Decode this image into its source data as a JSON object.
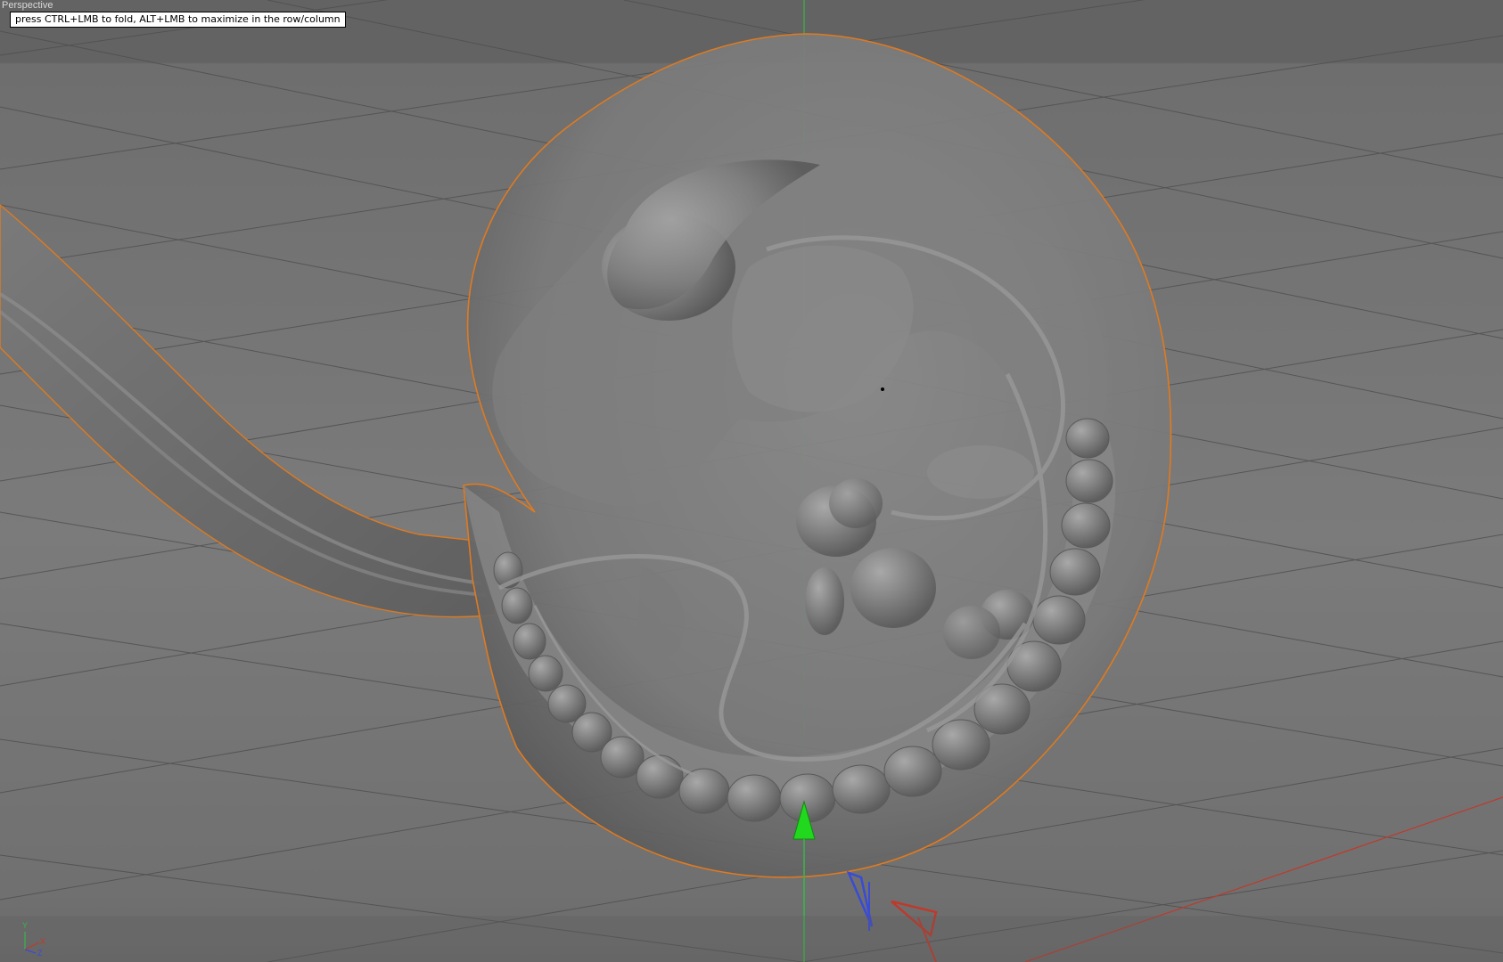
{
  "viewport": {
    "label": "Perspective",
    "tooltip": "press CTRL+LMB to fold, ALT+LMB to maximize in the row/column"
  },
  "axis_indicator": {
    "y_label": "Y",
    "x_label": "X",
    "z_label": "Z"
  },
  "colors": {
    "background": "#6b6b6b",
    "grid_line": "#4f4f4f",
    "y_axis": "#39b54a",
    "x_axis": "#c0392b",
    "z_axis": "#3a4bd6",
    "selection_outline": "#e07a1f",
    "move_arrow": "#22d81f"
  }
}
